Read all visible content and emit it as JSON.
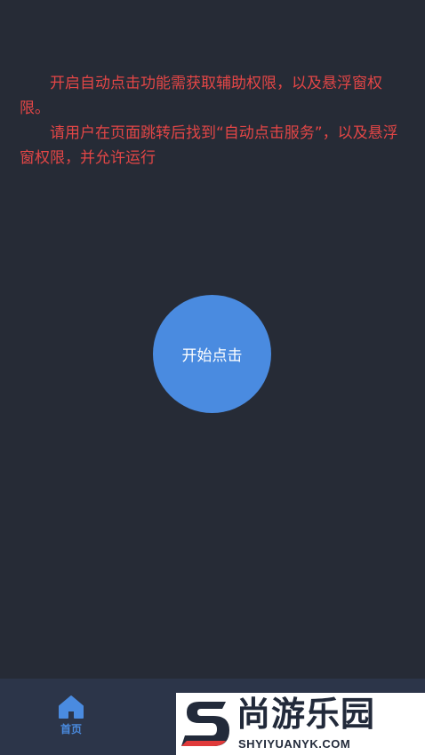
{
  "notice": {
    "line1": "开启自动点击功能需获取辅助权限，以及悬浮窗权限。",
    "line2": "请用户在页面跳转后找到“自动点击服务”，以及悬浮窗权限，并允许运行"
  },
  "main": {
    "start_button_label": "开始点击"
  },
  "tabbar": {
    "home_label": "首页",
    "home_icon": "home-icon"
  },
  "watermark": {
    "title": "尚游乐园",
    "url": "SHYIYUANYK.COM"
  },
  "colors": {
    "background": "#262b36",
    "notice_text": "#e34646",
    "accent": "#4a8be0",
    "tabbar": "#2c3549"
  }
}
